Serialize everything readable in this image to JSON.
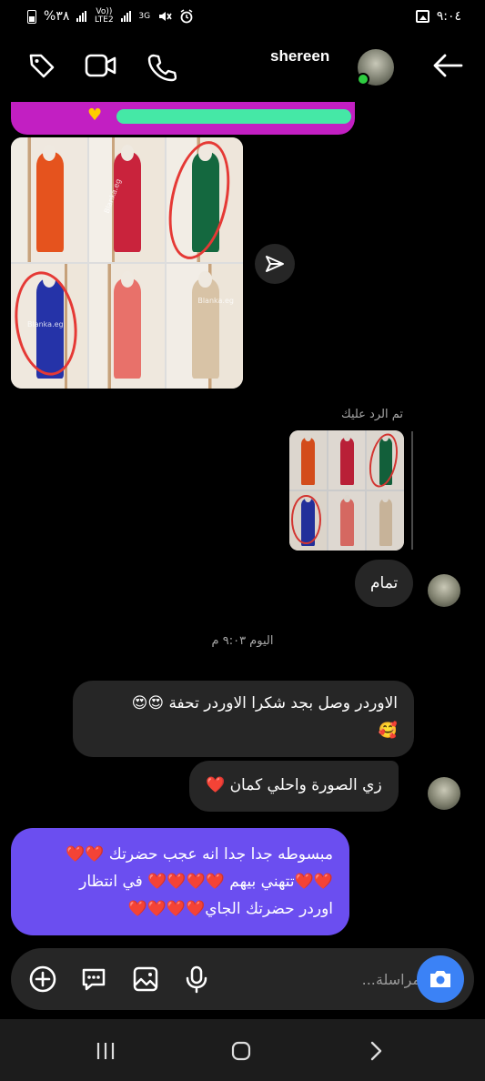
{
  "status_bar": {
    "time": "٩:٠٤",
    "battery": "%٣٨",
    "network_1": "Vo)) LTE2",
    "network_2": "3G",
    "icons": [
      "battery-icon",
      "signal-icon",
      "mute-icon",
      "alarm-icon",
      "gallery-icon"
    ]
  },
  "header": {
    "contact_name": "shereen",
    "icons": [
      "back-arrow-icon",
      "phone-icon",
      "video-icon",
      "tag-icon"
    ]
  },
  "messages": {
    "reply_label": "تم الرد عليك",
    "reply_text": "تمام",
    "timestamp": "اليوم ٩:٠٣ م",
    "msg1_line1": "الاوردر وصل بجد شكرا الاوردر تحفة 😍😍",
    "msg1_line2": "🥰",
    "msg2": "زي الصورة واحلي كمان ❤️",
    "msg3_line1": "مبسوطه جدا جدا انه عجب حضرتك ❤️❤️",
    "msg3_line2": "❤️❤️تتهني بيهم ❤️❤️❤️❤️ في انتظار",
    "msg3_line3": "اوردر حضرتك الجاي❤️❤️❤️❤️"
  },
  "images": {
    "watermark": "Blanka.eg",
    "dress_colors": [
      "#e5531e",
      "#c9233c",
      "#14683f",
      "#2533a8",
      "#e8716a",
      "#d8c3a6"
    ]
  },
  "composer": {
    "placeholder": "مراسلة..."
  },
  "colors": {
    "sent_bubble": "#6b4ef0",
    "received_bubble": "#262626",
    "accent_blue": "#3b82f6",
    "prev_msg": "#c21fc2",
    "online": "#2ecc40"
  }
}
